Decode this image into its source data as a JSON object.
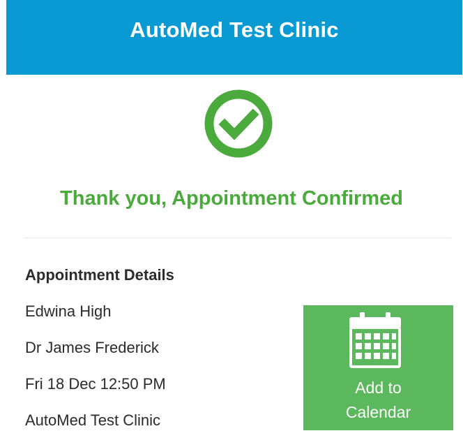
{
  "header": {
    "title": "AutoMed Test Clinic",
    "background_color": "#0a9ad3"
  },
  "confirmation": {
    "icon": "check-circle-icon",
    "message": "Thank you, Appointment Confirmed",
    "color": "#4aaa3c"
  },
  "details": {
    "title": "Appointment Details",
    "patient_name": "Edwina High",
    "doctor": "Dr James Frederick",
    "datetime": "Fri 18 Dec 12:50 PM",
    "clinic": "AutoMed Test Clinic"
  },
  "calendar_button": {
    "icon": "calendar-icon",
    "label_line1": "Add to",
    "label_line2": "Calendar",
    "color": "#5cb85c"
  }
}
